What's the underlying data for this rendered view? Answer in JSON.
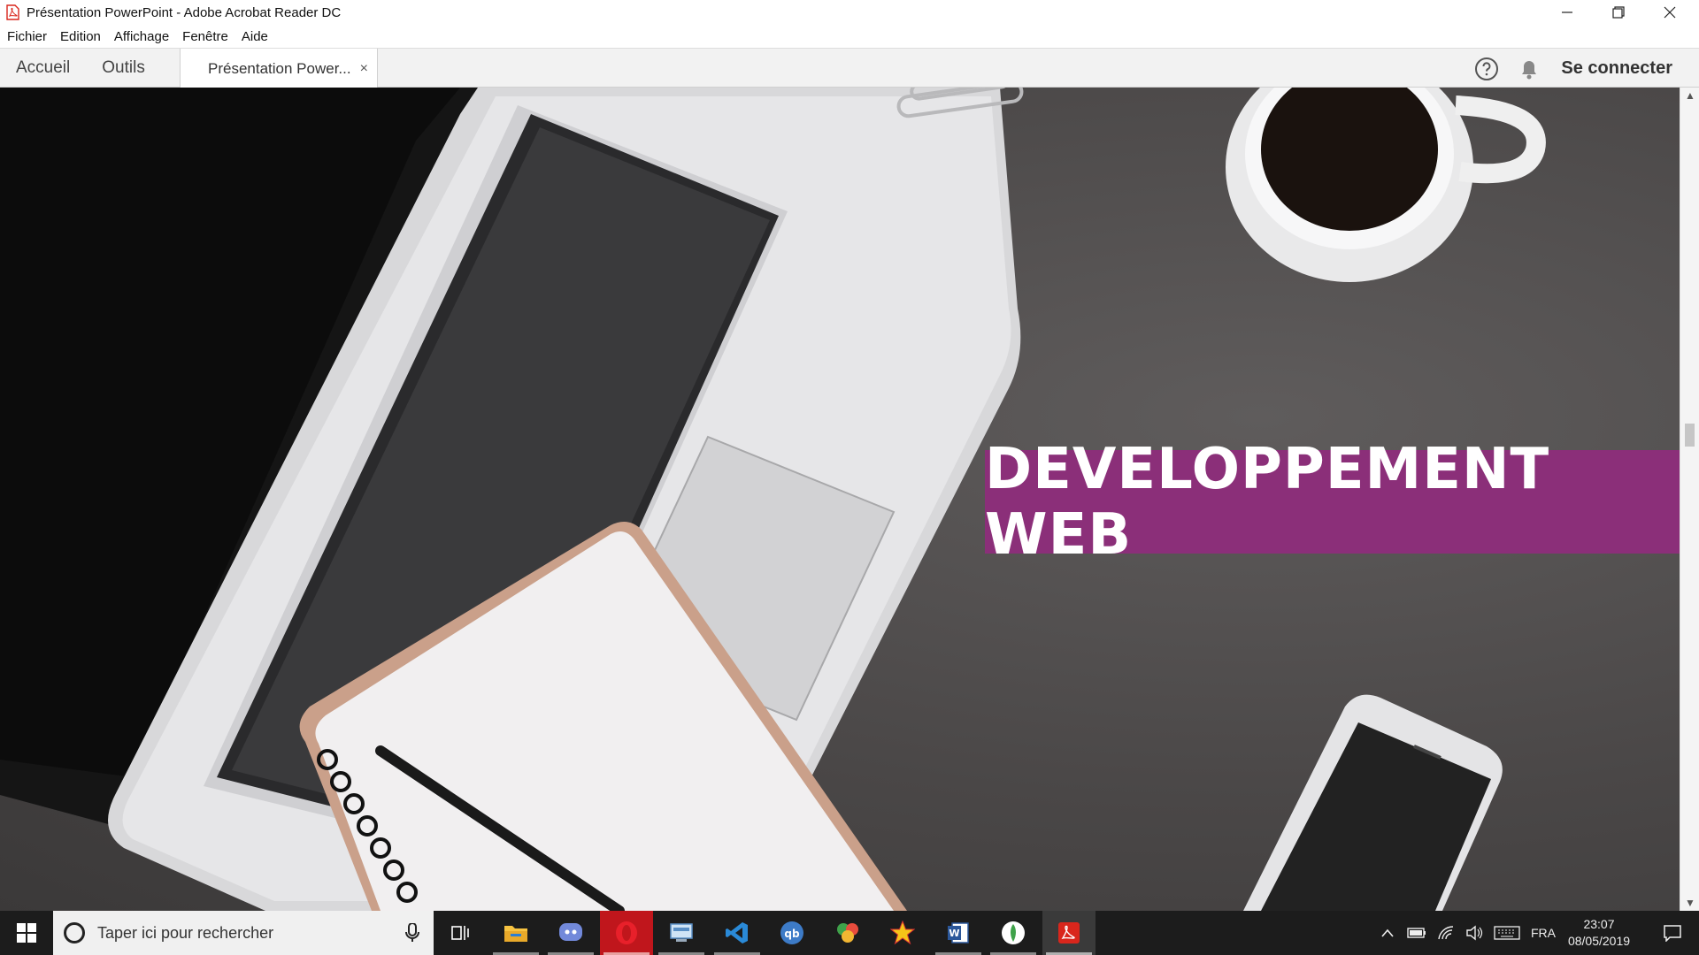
{
  "window": {
    "title": "Présentation PowerPoint - Adobe Acrobat Reader DC"
  },
  "menu": {
    "items": [
      "Fichier",
      "Edition",
      "Affichage",
      "Fenêtre",
      "Aide"
    ]
  },
  "toolbar": {
    "home_tab": "Accueil",
    "tools_tab": "Outils",
    "document_tab": "Présentation Power...",
    "close_tab": "×",
    "sign_in": "Se connecter"
  },
  "document": {
    "banner_text": "DEVELOPPEMENT WEB",
    "banner_color": "#8b2f79"
  },
  "taskbar": {
    "search_placeholder": "Taper ici pour rechercher",
    "apps": [
      "task-view-icon",
      "file-explorer-icon",
      "discord-icon",
      "opera-icon",
      "control-panel-icon",
      "vscode-icon",
      "qbittorrent-icon",
      "paint-icon",
      "star-app-icon",
      "word-icon",
      "mongodb-icon",
      "acrobat-icon"
    ],
    "language": "FRA",
    "time": "23:07",
    "date": "08/05/2019"
  }
}
